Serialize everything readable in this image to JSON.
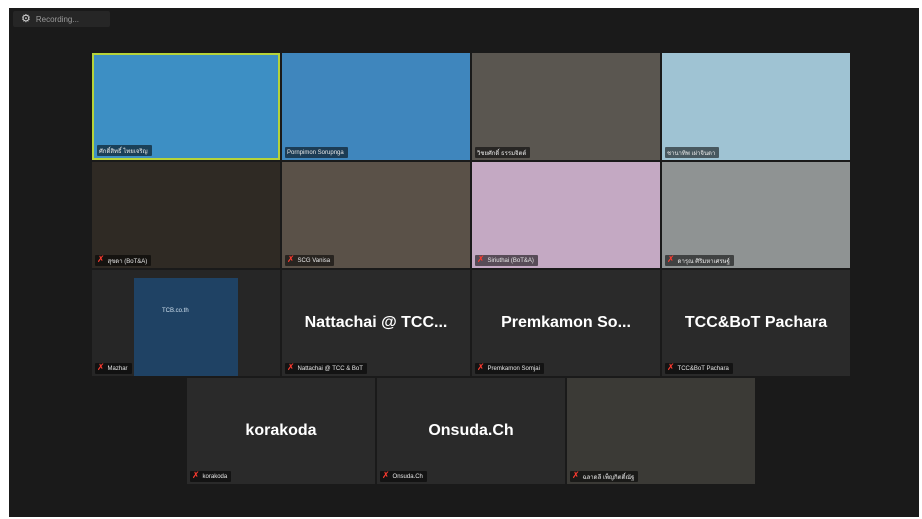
{
  "recording": {
    "label": "Recording...",
    "icon": "recording-gear-icon"
  },
  "participants": [
    {
      "name": "ศักดิ์สิทธิ์ ไทยเจริญ",
      "bg": "#3d8fc4",
      "active": true,
      "muted": false,
      "has_video": true
    },
    {
      "name": "Pornpimon Sorupnga",
      "bg": "#3f86bd",
      "active": false,
      "muted": false,
      "has_video": true
    },
    {
      "name": "วิชยศักดิ์ ธรรมจิตต์",
      "bg": "#5a5650",
      "active": false,
      "muted": false,
      "has_video": true
    },
    {
      "name": "ชานาทิพ เผ่าจินดา",
      "bg": "#9fc3d3",
      "active": false,
      "muted": false,
      "has_video": true
    },
    {
      "name": "สุขดา (BoT&A)",
      "bg": "#2f2a24",
      "active": false,
      "muted": true,
      "has_video": true
    },
    {
      "name": "SCG Vanisa",
      "bg": "#5a5148",
      "active": false,
      "muted": true,
      "has_video": true
    },
    {
      "name": "Siriuthai (BoT&A)",
      "bg": "#c4a9c3",
      "active": false,
      "muted": true,
      "has_video": true
    },
    {
      "name": "ดารุณ ศิริมหาเศรษฐ์",
      "bg": "#8f9393",
      "active": false,
      "muted": true,
      "has_video": true
    },
    {
      "name": "Mazhar",
      "bg": "#1f4264",
      "active": false,
      "muted": true,
      "has_video": true,
      "overlay": "TCB.co.th"
    },
    {
      "name": "Nattachai @ TCC & BoT",
      "display": "Nattachai @ TCC...",
      "active": false,
      "muted": true,
      "has_video": false
    },
    {
      "name": "Premkamon Somjai",
      "display": "Premkamon  So...",
      "active": false,
      "muted": true,
      "has_video": false
    },
    {
      "name": "TCC&BoT Pachara",
      "display": "TCC&BoT Pachara",
      "active": false,
      "muted": true,
      "has_video": false
    },
    {
      "name": "korakoda",
      "display": "korakoda",
      "active": false,
      "muted": true,
      "has_video": false
    },
    {
      "name": "Onsuda.Ch",
      "display": "Onsuda.Ch",
      "active": false,
      "muted": true,
      "has_video": false
    },
    {
      "name": "ฉลาดลี เพ็ญกิตติ์ณัฐ",
      "bg": "#3b3a36",
      "active": false,
      "muted": true,
      "has_video": true
    }
  ]
}
